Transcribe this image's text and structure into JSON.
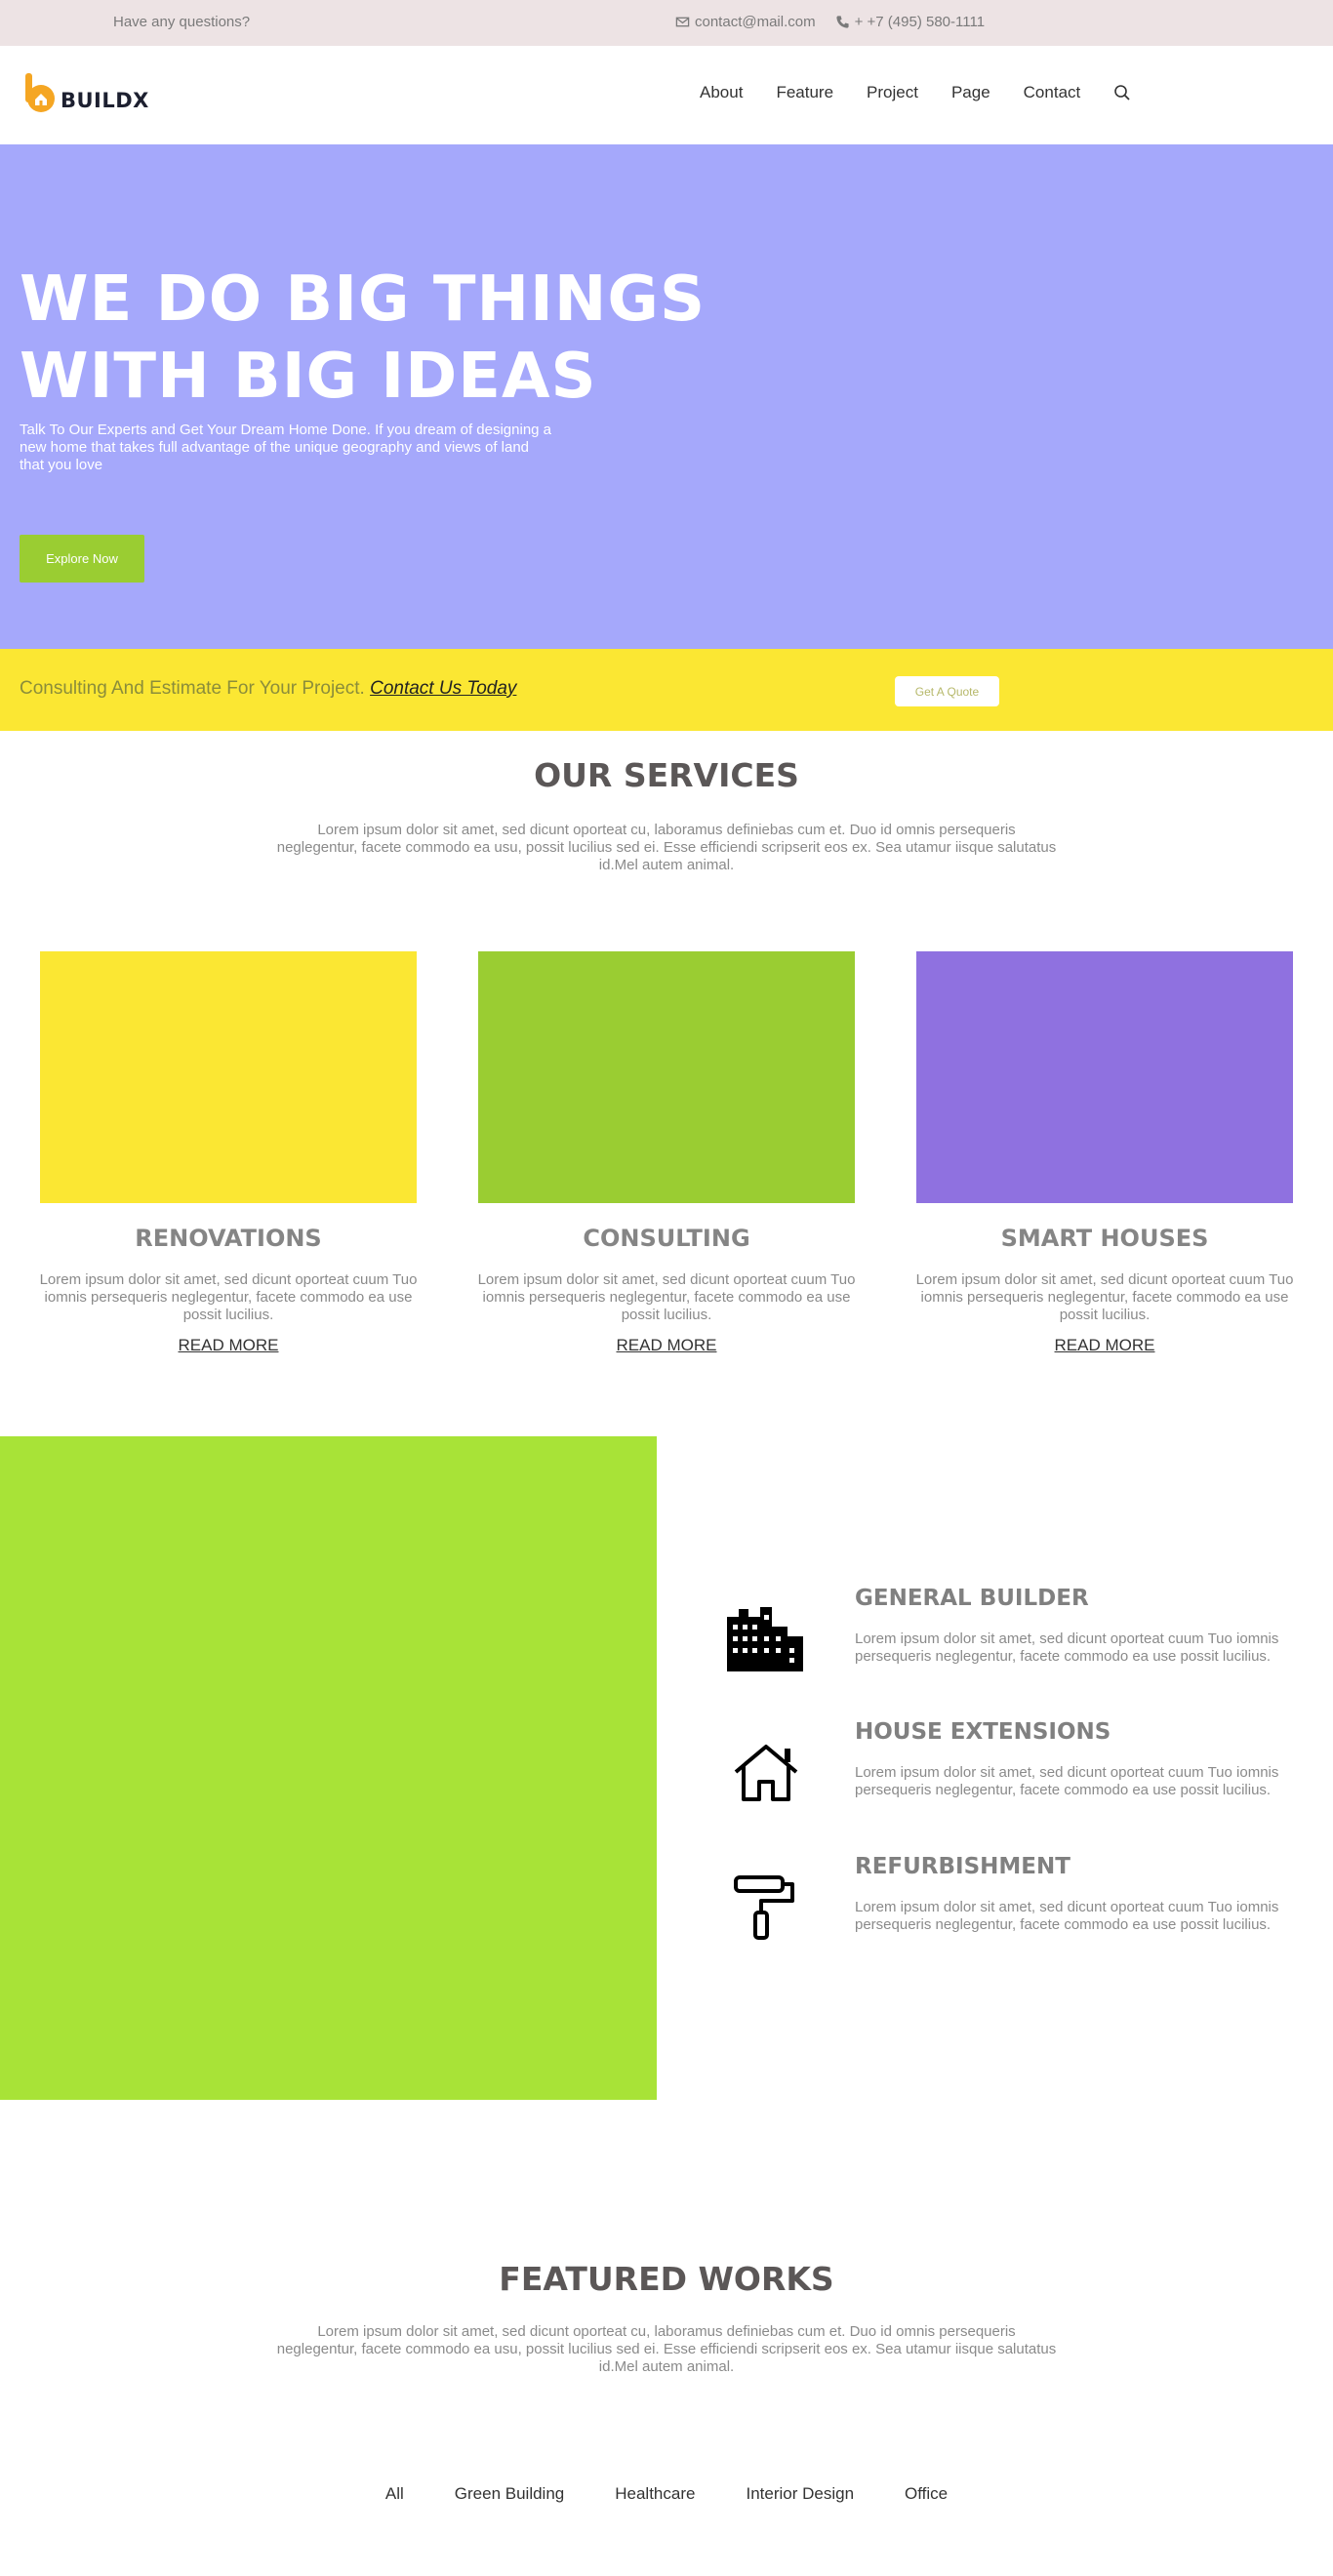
{
  "topbar": {
    "question": "Have any questions?",
    "email": "contact@mail.com",
    "phone": "+ +7 (495) 580-1111"
  },
  "header": {
    "logo_text": "BUILDX",
    "nav": [
      "About",
      "Feature",
      "Project",
      "Page",
      "Contact"
    ]
  },
  "hero": {
    "title": "WE DO BIG THINGS WITH BIG IDEAS",
    "subtitle": "Talk To Our Experts and Get Your Dream Home Done. If you dream of designing a new home that takes full advantage of the unique geography and views of land that you love",
    "button": "Explore Now"
  },
  "cta": {
    "text": "Consulting And Estimate For Your Project.",
    "link": "Contact Us Today",
    "button": "Get A Quote"
  },
  "services": {
    "title": "OUR SERVICES",
    "description": "Lorem ipsum dolor sit amet, sed dicunt oporteat cu, laboramus definiebas cum et. Duo id omnis persequeris neglegentur, facete commodo ea usu, possit lucilius sed ei. Esse efficiendi scripserit eos ex. Sea utamur iisque salutatus id.Mel autem animal.",
    "cards": [
      {
        "title": "RENOVATIONS",
        "text": "Lorem ipsum dolor sit amet, sed dicunt oporteat cuum Tuo iomnis persequeris neglegentur, facete commodo ea use possit lucilius.",
        "link": "READ MORE",
        "color": "#fbe733"
      },
      {
        "title": "CONSULTING",
        "text": "Lorem ipsum dolor sit amet, sed dicunt oporteat cuum Tuo iomnis persequeris neglegentur, facete commodo ea use possit lucilius.",
        "link": "READ MORE",
        "color": "#9acd32"
      },
      {
        "title": "SMART HOUSES",
        "text": "Lorem ipsum dolor sit amet, sed dicunt oporteat cuum Tuo iomnis persequeris neglegentur, facete commodo ea use possit lucilius.",
        "link": "READ MORE",
        "color": "#8f71e0"
      }
    ]
  },
  "features": {
    "panel_color": "#a8e337",
    "items": [
      {
        "title": "GENERAL BUILDER",
        "text": "Lorem ipsum dolor sit amet, sed dicunt oporteat cuum Tuo iomnis persequeris neglegentur, facete commodo ea use possit lucilius.",
        "icon": "building-icon"
      },
      {
        "title": "HOUSE EXTENSIONS",
        "text": "Lorem ipsum dolor sit amet, sed dicunt oporteat cuum Tuo iomnis persequeris neglegentur, facete commodo ea use possit lucilius.",
        "icon": "house-icon"
      },
      {
        "title": "REFURBISHMENT",
        "text": "Lorem ipsum dolor sit amet, sed dicunt oporteat cuum Tuo iomnis persequeris neglegentur, facete commodo ea use possit lucilius.",
        "icon": "paint-roller-icon"
      }
    ]
  },
  "works": {
    "title": "FEATURED WORKS",
    "description": "Lorem ipsum dolor sit amet, sed dicunt oporteat cu, laboramus definiebas cum et. Duo id omnis persequeris neglegentur, facete commodo ea usu, possit lucilius sed ei. Esse efficiendi scripserit eos ex. Sea utamur iisque salutatus id.Mel autem animal.",
    "filters": [
      "All",
      "Green Building",
      "Healthcare",
      "Interior Design",
      "Office"
    ]
  },
  "colors": {
    "hero_bg": "#a5a8fb",
    "cta_bg": "#fbe733",
    "accent_green": "#9acd32",
    "logo_orange": "#f5a623"
  }
}
